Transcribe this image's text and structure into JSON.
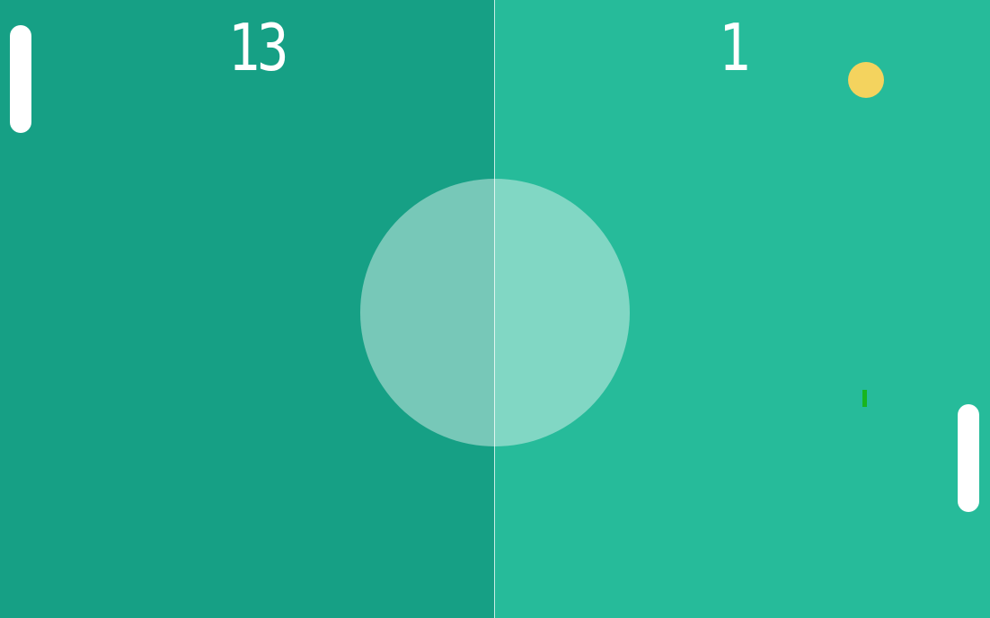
{
  "scoreboard": {
    "left_score": "13",
    "right_score": "1"
  },
  "colors": {
    "left_field": "#16a085",
    "right_field": "#26bb9a",
    "center_circle": "#82cdb8",
    "paddles": "#ffffff",
    "ball": "#f4d35e",
    "marker": "#18b51f"
  },
  "icons": {
    "ball": "ball-icon",
    "left_paddle": "paddle-icon",
    "right_paddle": "paddle-icon"
  }
}
